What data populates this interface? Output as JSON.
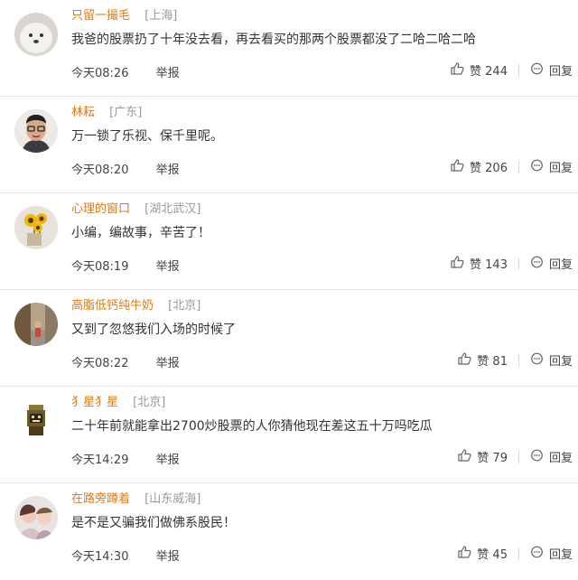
{
  "comments": [
    {
      "user": "只留一撮毛",
      "location": "[上海]",
      "text": "我爸的股票扔了十年没去看，再去看买的那两个股票都没了二哈二哈二哈",
      "time": "今天08:26",
      "report": "举报",
      "likes_label": "赞 244",
      "reply_label": "回复",
      "avatar": "white-dog-avatar"
    },
    {
      "user": "林耘",
      "location": "[广东]",
      "text": "万一锁了乐视、保千里呢。",
      "time": "今天08:20",
      "report": "举报",
      "likes_label": "赞 206",
      "reply_label": "回复",
      "avatar": "man-with-glasses-avatar"
    },
    {
      "user": "心理的窗口",
      "location": "[湖北武汉]",
      "text": "小编，编故事，辛苦了！",
      "time": "今天08:19",
      "report": "举报",
      "likes_label": "赞 143",
      "reply_label": "回复",
      "avatar": "sunflower-avatar"
    },
    {
      "user": "高脂低钙纯牛奶",
      "location": "[北京]",
      "text": "又到了忽悠我们入场的时候了",
      "time": "今天08:22",
      "report": "举报",
      "likes_label": "赞 81",
      "reply_label": "回复",
      "avatar": "street-photo-avatar"
    },
    {
      "user": "犭星犭星",
      "location": "[北京]",
      "text": "二十年前就能拿出2700炒股票的人你猜他现在差这五十万吗吃瓜",
      "time": "今天14:29",
      "report": "举报",
      "likes_label": "赞 79",
      "reply_label": "回复",
      "avatar": "pixel-figure-avatar"
    },
    {
      "user": "在路旁蹲着",
      "location": "[山东威海]",
      "text": "是不是又骗我们做佛系股民！",
      "time": "今天14:30",
      "report": "举报",
      "likes_label": "赞 45",
      "reply_label": "回复",
      "avatar": "couple-photo-avatar"
    }
  ],
  "colors": {
    "username": "#e07a18",
    "location": "#999999",
    "divider": "#e6e6e6"
  }
}
